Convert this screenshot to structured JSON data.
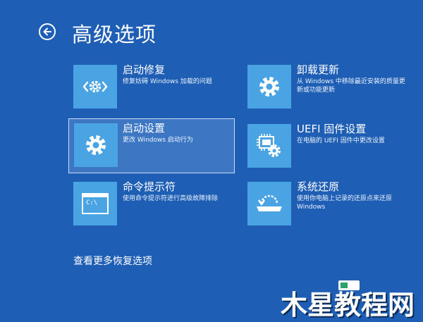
{
  "header": {
    "back_icon": "back-arrow-icon",
    "title": "高级选项"
  },
  "options": [
    {
      "title": "启动修复",
      "desc": "修复妨碍 Windows 加载的问题",
      "icon": "startup-repair-icon",
      "selected": false
    },
    {
      "title": "卸载更新",
      "desc": "从 Windows 中移除最近安装的质量更新或功能更新",
      "icon": "gear-icon",
      "selected": false
    },
    {
      "title": "启动设置",
      "desc": "更改 Windows 启动行为",
      "icon": "gear-icon",
      "selected": true
    },
    {
      "title": "UEFI 固件设置",
      "desc": "在电脑的 UEFI 固件中更改设置",
      "icon": "firmware-chip-gear-icon",
      "selected": false
    },
    {
      "title": "命令提示符",
      "desc": "使用命令提示符进行高级故障排除",
      "icon": "command-prompt-icon",
      "selected": false
    },
    {
      "title": "系统还原",
      "desc": "使用你电脑上记录的还原点来还原 Windows",
      "icon": "system-restore-icon",
      "selected": false
    }
  ],
  "cmd_icon_text": "C:\\",
  "more_link": "查看更多恢复选项",
  "watermark": {
    "text": "木星教程网"
  },
  "colors": {
    "background": "#1e5fb5",
    "tile": "#4aa3e3",
    "selected_background": "#3d77c4",
    "selected_border": "#c9dcf3"
  }
}
